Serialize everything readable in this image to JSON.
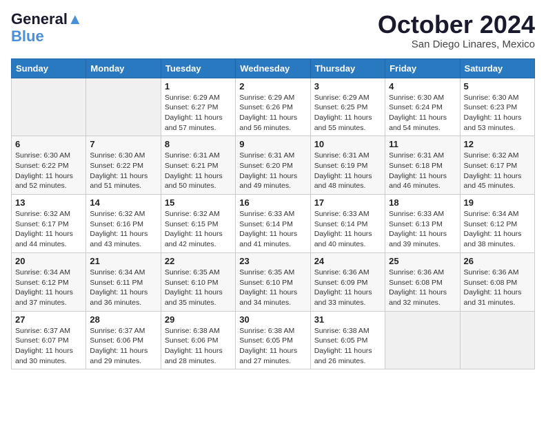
{
  "logo": {
    "line1": "General",
    "line2": "Blue"
  },
  "title": "October 2024",
  "subtitle": "San Diego Linares, Mexico",
  "days_of_week": [
    "Sunday",
    "Monday",
    "Tuesday",
    "Wednesday",
    "Thursday",
    "Friday",
    "Saturday"
  ],
  "weeks": [
    [
      {
        "day": "",
        "info": ""
      },
      {
        "day": "",
        "info": ""
      },
      {
        "day": "1",
        "info": "Sunrise: 6:29 AM\nSunset: 6:27 PM\nDaylight: 11 hours and 57 minutes."
      },
      {
        "day": "2",
        "info": "Sunrise: 6:29 AM\nSunset: 6:26 PM\nDaylight: 11 hours and 56 minutes."
      },
      {
        "day": "3",
        "info": "Sunrise: 6:29 AM\nSunset: 6:25 PM\nDaylight: 11 hours and 55 minutes."
      },
      {
        "day": "4",
        "info": "Sunrise: 6:30 AM\nSunset: 6:24 PM\nDaylight: 11 hours and 54 minutes."
      },
      {
        "day": "5",
        "info": "Sunrise: 6:30 AM\nSunset: 6:23 PM\nDaylight: 11 hours and 53 minutes."
      }
    ],
    [
      {
        "day": "6",
        "info": "Sunrise: 6:30 AM\nSunset: 6:22 PM\nDaylight: 11 hours and 52 minutes."
      },
      {
        "day": "7",
        "info": "Sunrise: 6:30 AM\nSunset: 6:22 PM\nDaylight: 11 hours and 51 minutes."
      },
      {
        "day": "8",
        "info": "Sunrise: 6:31 AM\nSunset: 6:21 PM\nDaylight: 11 hours and 50 minutes."
      },
      {
        "day": "9",
        "info": "Sunrise: 6:31 AM\nSunset: 6:20 PM\nDaylight: 11 hours and 49 minutes."
      },
      {
        "day": "10",
        "info": "Sunrise: 6:31 AM\nSunset: 6:19 PM\nDaylight: 11 hours and 48 minutes."
      },
      {
        "day": "11",
        "info": "Sunrise: 6:31 AM\nSunset: 6:18 PM\nDaylight: 11 hours and 46 minutes."
      },
      {
        "day": "12",
        "info": "Sunrise: 6:32 AM\nSunset: 6:17 PM\nDaylight: 11 hours and 45 minutes."
      }
    ],
    [
      {
        "day": "13",
        "info": "Sunrise: 6:32 AM\nSunset: 6:17 PM\nDaylight: 11 hours and 44 minutes."
      },
      {
        "day": "14",
        "info": "Sunrise: 6:32 AM\nSunset: 6:16 PM\nDaylight: 11 hours and 43 minutes."
      },
      {
        "day": "15",
        "info": "Sunrise: 6:32 AM\nSunset: 6:15 PM\nDaylight: 11 hours and 42 minutes."
      },
      {
        "day": "16",
        "info": "Sunrise: 6:33 AM\nSunset: 6:14 PM\nDaylight: 11 hours and 41 minutes."
      },
      {
        "day": "17",
        "info": "Sunrise: 6:33 AM\nSunset: 6:14 PM\nDaylight: 11 hours and 40 minutes."
      },
      {
        "day": "18",
        "info": "Sunrise: 6:33 AM\nSunset: 6:13 PM\nDaylight: 11 hours and 39 minutes."
      },
      {
        "day": "19",
        "info": "Sunrise: 6:34 AM\nSunset: 6:12 PM\nDaylight: 11 hours and 38 minutes."
      }
    ],
    [
      {
        "day": "20",
        "info": "Sunrise: 6:34 AM\nSunset: 6:12 PM\nDaylight: 11 hours and 37 minutes."
      },
      {
        "day": "21",
        "info": "Sunrise: 6:34 AM\nSunset: 6:11 PM\nDaylight: 11 hours and 36 minutes."
      },
      {
        "day": "22",
        "info": "Sunrise: 6:35 AM\nSunset: 6:10 PM\nDaylight: 11 hours and 35 minutes."
      },
      {
        "day": "23",
        "info": "Sunrise: 6:35 AM\nSunset: 6:10 PM\nDaylight: 11 hours and 34 minutes."
      },
      {
        "day": "24",
        "info": "Sunrise: 6:36 AM\nSunset: 6:09 PM\nDaylight: 11 hours and 33 minutes."
      },
      {
        "day": "25",
        "info": "Sunrise: 6:36 AM\nSunset: 6:08 PM\nDaylight: 11 hours and 32 minutes."
      },
      {
        "day": "26",
        "info": "Sunrise: 6:36 AM\nSunset: 6:08 PM\nDaylight: 11 hours and 31 minutes."
      }
    ],
    [
      {
        "day": "27",
        "info": "Sunrise: 6:37 AM\nSunset: 6:07 PM\nDaylight: 11 hours and 30 minutes."
      },
      {
        "day": "28",
        "info": "Sunrise: 6:37 AM\nSunset: 6:06 PM\nDaylight: 11 hours and 29 minutes."
      },
      {
        "day": "29",
        "info": "Sunrise: 6:38 AM\nSunset: 6:06 PM\nDaylight: 11 hours and 28 minutes."
      },
      {
        "day": "30",
        "info": "Sunrise: 6:38 AM\nSunset: 6:05 PM\nDaylight: 11 hours and 27 minutes."
      },
      {
        "day": "31",
        "info": "Sunrise: 6:38 AM\nSunset: 6:05 PM\nDaylight: 11 hours and 26 minutes."
      },
      {
        "day": "",
        "info": ""
      },
      {
        "day": "",
        "info": ""
      }
    ]
  ]
}
